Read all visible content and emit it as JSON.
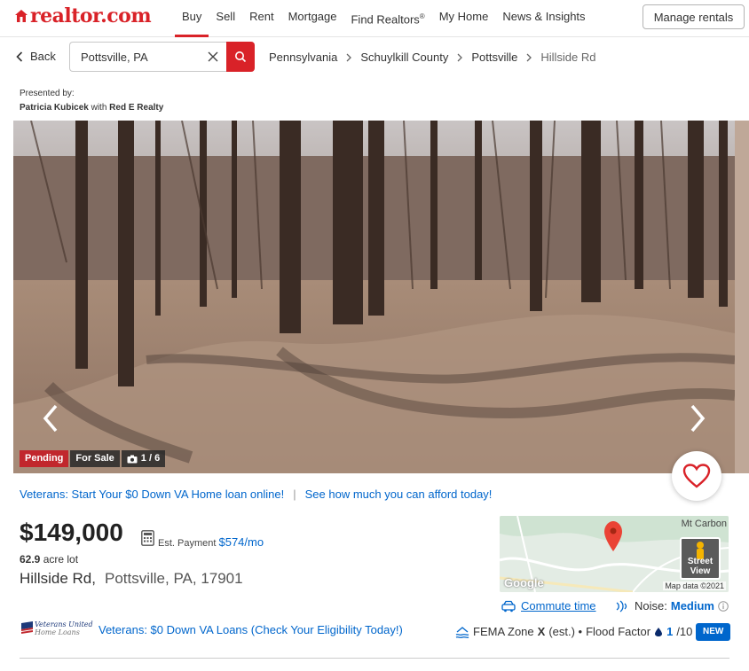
{
  "header": {
    "brand": "realtor.com",
    "nav": [
      {
        "label": "Buy",
        "active": true
      },
      {
        "label": "Sell"
      },
      {
        "label": "Rent"
      },
      {
        "label": "Mortgage"
      },
      {
        "label": "Find Realtors",
        "sup": "®"
      },
      {
        "label": "My Home"
      },
      {
        "label": "News & Insights"
      }
    ],
    "manage_label": "Manage rentals"
  },
  "search": {
    "back_label": "Back",
    "value": "Pottsville, PA"
  },
  "breadcrumb": [
    "Pennsylvania",
    "Schuylkill County",
    "Pottsville",
    "Hillside Rd"
  ],
  "presented": {
    "label": "Presented by:",
    "agent": "Patricia Kubicek",
    "with": "with",
    "brokerage": "Red E Realty"
  },
  "photo": {
    "status_badge": "Pending",
    "type_badge": "For Sale",
    "photo_count": "1 / 6"
  },
  "promo": {
    "va_link": "Veterans: Start Your $0 Down VA Home loan online!",
    "divider": "|",
    "afford_link": "See how much you can afford today!"
  },
  "listing": {
    "price": "$149,000",
    "est_label": "Est. Payment",
    "est_value": "$574/mo",
    "lot_size": "62.9",
    "lot_unit": "acre lot",
    "street": "Hillside Rd,",
    "city_state_zip": "Pottsville, PA, 17901"
  },
  "map": {
    "place_label": "Mt Carbon",
    "google_label": "Google",
    "attribution": "Map data ©2021",
    "street_view_label_1": "Street",
    "street_view_label_2": "View"
  },
  "map_info": {
    "commute_label": "Commute time",
    "noise_label": "Noise:",
    "noise_value": "Medium"
  },
  "va_banner": {
    "logo_line1": "Veterans United",
    "logo_line2": "Home Loans",
    "link": "Veterans: $0 Down VA Loans (Check Your Eligibility Today!)"
  },
  "risk": {
    "fema_label": "FEMA Zone",
    "fema_zone": "X",
    "fema_suffix": "(est.) •",
    "flood_label": "Flood Factor",
    "flood_value": "1",
    "flood_scale": "/10",
    "new_badge": "NEW"
  },
  "colors": {
    "brand_red": "#d92228",
    "link_blue": "#0066cc",
    "pending_red": "#c1272d"
  }
}
